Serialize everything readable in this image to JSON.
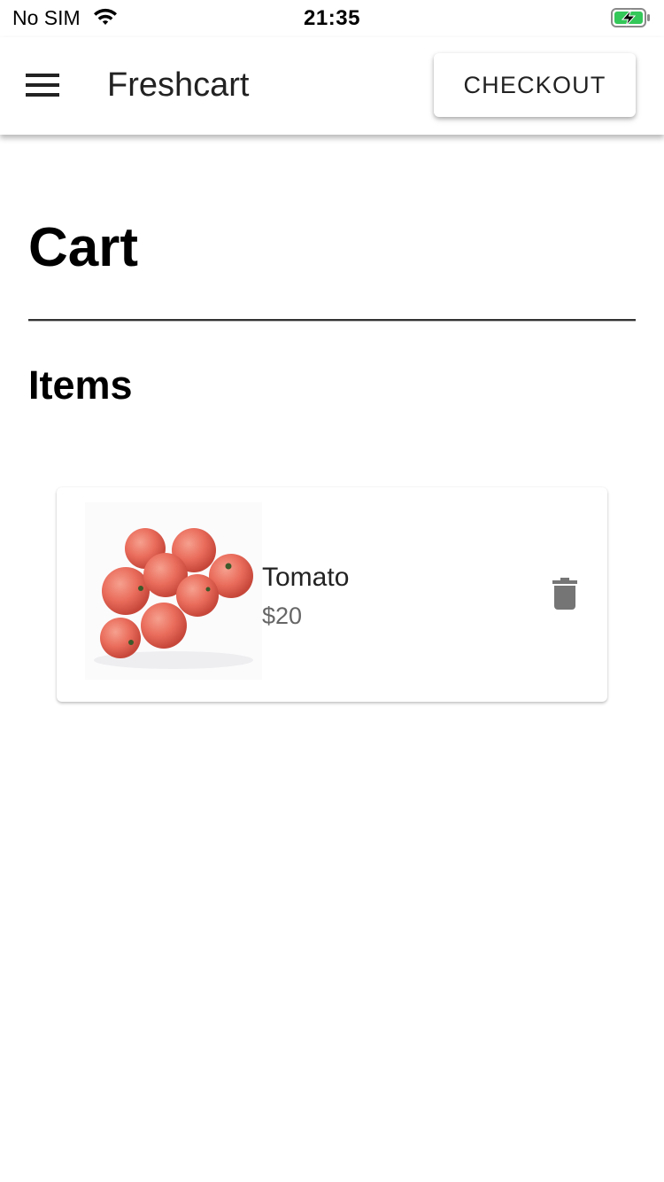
{
  "status_bar": {
    "carrier": "No SIM",
    "time": "21:35",
    "battery_color": "#34c759"
  },
  "app_bar": {
    "title": "Freshcart",
    "checkout_label": "CHECKOUT",
    "menu_icon": "hamburger-menu-icon"
  },
  "page": {
    "title": "Cart",
    "section_title": "Items"
  },
  "cart": {
    "items": [
      {
        "name": "Tomato",
        "price": "$20",
        "image": "tomatoes-photo",
        "delete_icon": "trash-icon"
      }
    ]
  }
}
